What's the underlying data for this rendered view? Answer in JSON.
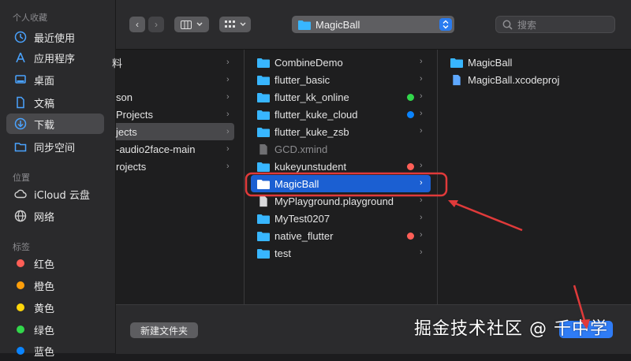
{
  "sidebar": {
    "favorites_heading": "个人收藏",
    "favorites": [
      {
        "label": "最近使用",
        "icon": "clock-icon"
      },
      {
        "label": "应用程序",
        "icon": "apps-icon"
      },
      {
        "label": "桌面",
        "icon": "desktop-icon"
      },
      {
        "label": "文稿",
        "icon": "document-icon"
      },
      {
        "label": "下载",
        "icon": "download-icon",
        "selected": true
      },
      {
        "label": "同步空间",
        "icon": "folder-icon"
      }
    ],
    "locations_heading": "位置",
    "locations": [
      {
        "label": "iCloud 云盘",
        "icon": "cloud-icon"
      },
      {
        "label": "网络",
        "icon": "globe-icon"
      }
    ],
    "tags_heading": "标签",
    "tags": [
      {
        "label": "红色",
        "color": "#ff5f57"
      },
      {
        "label": "橙色",
        "color": "#ff9f0a"
      },
      {
        "label": "黄色",
        "color": "#ffd60a"
      },
      {
        "label": "绿色",
        "color": "#32d74b"
      },
      {
        "label": "蓝色",
        "color": "#0a84ff"
      }
    ]
  },
  "toolbar": {
    "path_label": "MagicBall",
    "search_placeholder": "搜索"
  },
  "columns": {
    "col1": [
      "料",
      "son",
      "Projects",
      "jects",
      "-audio2face-main",
      "rojects"
    ],
    "col2": [
      {
        "name": "CombineDemo",
        "type": "folder"
      },
      {
        "name": "flutter_basic",
        "type": "folder"
      },
      {
        "name": "flutter_kk_online",
        "type": "folder",
        "tag": "#32d74b"
      },
      {
        "name": "flutter_kuke_cloud",
        "type": "folder",
        "tag": "#0a84ff"
      },
      {
        "name": "flutter_kuke_zsb",
        "type": "folder"
      },
      {
        "name": "GCD.xmind",
        "type": "file"
      },
      {
        "name": "kukeyunstudent",
        "type": "folder",
        "tag": "#ff5f57"
      },
      {
        "name": "MagicBall",
        "type": "folder",
        "selected": true
      },
      {
        "name": "MyPlayground.playground",
        "type": "playground"
      },
      {
        "name": "MyTest0207",
        "type": "folder"
      },
      {
        "name": "native_flutter",
        "type": "folder",
        "tag": "#ff5f57"
      },
      {
        "name": "test",
        "type": "folder"
      }
    ],
    "col3": [
      {
        "name": "MagicBall",
        "type": "folder"
      },
      {
        "name": "MagicBall.xcodeproj",
        "type": "xcodeproj"
      }
    ]
  },
  "bottom": {
    "new_folder_label": "新建文件夹",
    "watermark": "掘金技术社区 @ 千中学"
  },
  "colors": {
    "accent": "#1b5fd2",
    "annotation_red": "#e03a3a"
  }
}
